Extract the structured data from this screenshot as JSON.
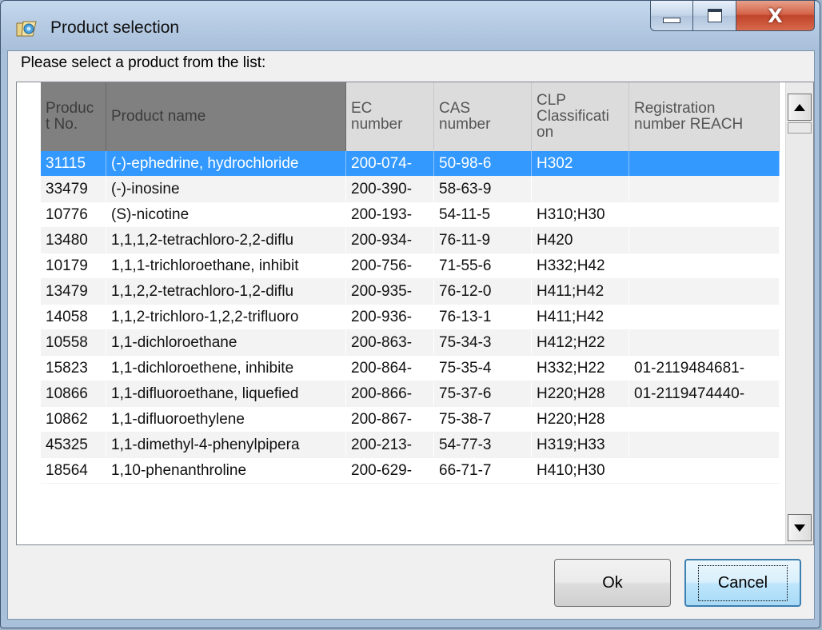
{
  "window": {
    "title": "Product selection",
    "close_glyph": "X"
  },
  "prompt": "Please select a product from the list:",
  "columns": [
    [
      "Produc",
      "t No."
    ],
    [
      "Product name"
    ],
    [
      "EC",
      "number"
    ],
    [
      "CAS",
      "number"
    ],
    [
      "CLP",
      "Classificati",
      "on"
    ],
    [
      "Registration",
      "number REACH"
    ]
  ],
  "rows": [
    [
      "31115",
      "(-)-ephedrine, hydrochloride",
      "200-074-",
      "50-98-6",
      "H302",
      ""
    ],
    [
      "33479",
      "(-)-inosine",
      "200-390-",
      "58-63-9",
      "",
      ""
    ],
    [
      "10776",
      "(S)-nicotine",
      "200-193-",
      "54-11-5",
      "H310;H30",
      ""
    ],
    [
      "13480",
      "1,1,1,2-tetrachloro-2,2-diflu",
      "200-934-",
      "76-11-9",
      "H420",
      ""
    ],
    [
      "10179",
      "1,1,1-trichloroethane, inhibit",
      "200-756-",
      "71-55-6",
      "H332;H42",
      ""
    ],
    [
      "13479",
      "1,1,2,2-tetrachloro-1,2-diflu",
      "200-935-",
      "76-12-0",
      "H411;H42",
      ""
    ],
    [
      "14058",
      "1,1,2-trichloro-1,2,2-trifluoro",
      "200-936-",
      "76-13-1",
      "H411;H42",
      ""
    ],
    [
      "10558",
      "1,1-dichloroethane",
      "200-863-",
      "75-34-3",
      "H412;H22",
      ""
    ],
    [
      "15823",
      "1,1-dichloroethene, inhibite",
      "200-864-",
      "75-35-4",
      "H332;H22",
      "01-2119484681-"
    ],
    [
      "10866",
      "1,1-difluoroethane, liquefied",
      "200-866-",
      "75-37-6",
      "H220;H28",
      "01-2119474440-"
    ],
    [
      "10862",
      "1,1-difluoroethylene",
      "200-867-",
      "75-38-7",
      "H220;H28",
      ""
    ],
    [
      "45325",
      "1,1-dimethyl-4-phenylpipera",
      "200-213-",
      "54-77-3",
      "H319;H33",
      ""
    ],
    [
      "18564",
      "1,10-phenanthroline",
      "200-629-",
      "66-71-7",
      "H410;H30",
      ""
    ]
  ],
  "selected_row": 0,
  "buttons": {
    "ok": "Ok",
    "cancel": "Cancel"
  },
  "colors": {
    "selection": "#3399ff",
    "header_dark": "#808080",
    "header_light": "#dcdcdc"
  }
}
